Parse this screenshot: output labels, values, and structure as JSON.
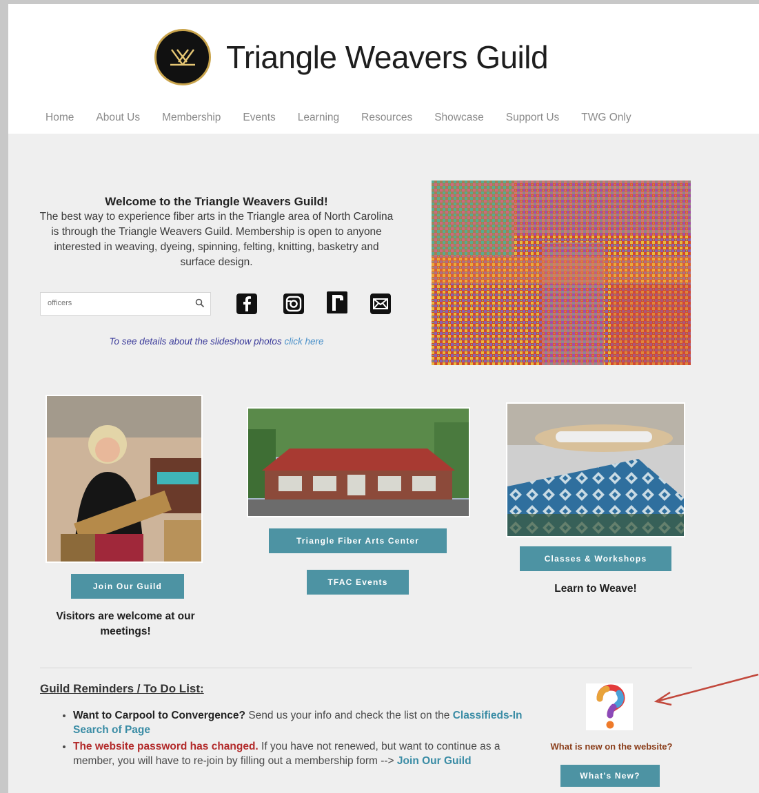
{
  "site": {
    "title": "Triangle Weavers Guild",
    "logo_icon": "woven-triangle-logo-icon"
  },
  "nav": [
    "Home",
    "About Us",
    "Membership",
    "Events",
    "Learning",
    "Resources",
    "Showcase",
    "Support Us",
    "TWG Only"
  ],
  "welcome": {
    "heading": "Welcome to the Triangle Weavers Guild!",
    "body": "The best way to experience fiber arts in the Triangle area of North Carolina is through the Triangle Weavers Guild. Membership is open to anyone interested in weaving, dyeing, spinning, felting, knitting, basketry and surface design."
  },
  "search": {
    "placeholder": "officers",
    "icon": "search-icon"
  },
  "social": [
    "facebook-icon",
    "instagram-icon",
    "ravelry-icon",
    "email-icon"
  ],
  "slideshow_note": {
    "text": "To see details about the slideshow photos ",
    "link": "click here"
  },
  "cards": {
    "join": {
      "button": "Join Our Guild",
      "caption": "Visitors are welcome at our meetings!"
    },
    "center": {
      "button": "Triangle Fiber Arts Center",
      "button2": "TFAC Events"
    },
    "classes": {
      "button": "Classes & Workshops",
      "caption": "Learn to Weave!"
    }
  },
  "reminders": {
    "title": "Guild Reminders / To Do List:",
    "item1_bold": "Want to Carpool to Convergence?",
    "item1_text": "  Send us your info and check the list on the ",
    "item1_link": "Classifieds-In Search of Page",
    "item2_bold": "The website password has changed.",
    "item2_text": "  If you have not renewed, but want to continue as a member, you will have to re-join by filling out a membership form --> ",
    "item2_link": "Join Our Guild"
  },
  "whats_new": {
    "caption": "What is new on the website?",
    "button": "What's New?",
    "icon": "question-mark-icon"
  },
  "colors": {
    "accent": "#4d93a3",
    "alert": "#b22a2a",
    "link": "#3a8ca5"
  }
}
